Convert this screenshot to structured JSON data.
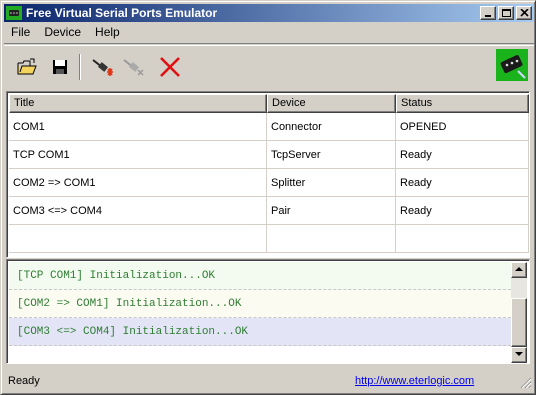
{
  "window": {
    "title": "Free Virtual Serial Ports Emulator",
    "app_icon": "serial-port-icon"
  },
  "title_buttons": {
    "minimize": "minimize-icon",
    "maximize": "maximize-icon",
    "close": "close-icon"
  },
  "menu": {
    "items": [
      "File",
      "Device",
      "Help"
    ]
  },
  "toolbar": {
    "open": "folder-open-icon",
    "save": "save-icon",
    "new_device": "new-device-icon",
    "remove_device": "remove-device-icon",
    "delete": "delete-icon",
    "logo": "eterlogic-logo-icon"
  },
  "table": {
    "columns": [
      "Title",
      "Device",
      "Status"
    ],
    "rows": [
      {
        "title": "COM1",
        "device": "Connector",
        "status": "OPENED"
      },
      {
        "title": "TCP COM1",
        "device": "TcpServer",
        "status": "Ready"
      },
      {
        "title": "COM2 => COM1",
        "device": "Splitter",
        "status": "Ready"
      },
      {
        "title": "COM3 <=> COM4",
        "device": "Pair",
        "status": "Ready"
      }
    ]
  },
  "log": {
    "lines": [
      {
        "text": "[TCP COM1] Initialization...OK",
        "bg": "#f3fbf1"
      },
      {
        "text": "[COM2 => COM1] Initialization...OK",
        "bg": "#fbfbf1"
      },
      {
        "text": "[COM3 <=> COM4] Initialization...OK",
        "bg": "#e3e5f7"
      }
    ],
    "text_color": "#2e7d32"
  },
  "status": {
    "text": "Ready",
    "link": "http://www.eterlogic.com"
  },
  "colors": {
    "title_gradient_start": "#0a246a",
    "title_gradient_end": "#a6caf0",
    "face": "#d4d0c8"
  }
}
